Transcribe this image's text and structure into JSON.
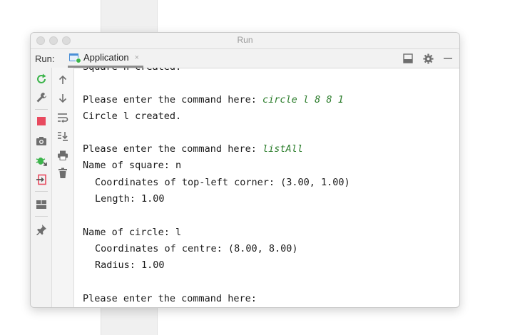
{
  "window": {
    "title": "Run"
  },
  "tabbar": {
    "run_label": "Run:",
    "tab_label": "Application",
    "tab_close": "×"
  },
  "console": {
    "lines": {
      "l0": "Square n created.",
      "l2_prompt": "Please enter the command here: ",
      "l2_cmd": "circle l 8 8 1",
      "l3": "Circle l created.",
      "l5_prompt": "Please enter the command here: ",
      "l5_cmd": "listAll",
      "l6": "Name of square: n",
      "l7": "Coordinates of top-left corner: (3.00, 1.00)",
      "l8": "Length: 1.00",
      "l10": "Name of circle: l",
      "l11": "Coordinates of centre: (8.00, 8.00)",
      "l12": "Radius: 1.00",
      "l14_prompt": "Please enter the command here:"
    }
  },
  "colors": {
    "command_text": "#2a7c2a",
    "rerun": "#3cb44b",
    "stop": "#e84a5f",
    "tab_icon": "#4a8fd6"
  },
  "icons": {
    "left_toolbar": [
      "rerun-icon",
      "wrench-icon",
      "stop-icon",
      "camera-icon",
      "debug-bug-icon",
      "exit-icon",
      "layout-icon",
      "pin-icon"
    ],
    "second_toolbar": [
      "arrow-up-icon",
      "arrow-down-icon",
      "soft-wrap-icon",
      "scroll-to-end-icon",
      "print-icon",
      "trash-icon"
    ],
    "tab_tools": [
      "layout-toggle-icon",
      "gear-icon",
      "minimize-icon"
    ]
  }
}
